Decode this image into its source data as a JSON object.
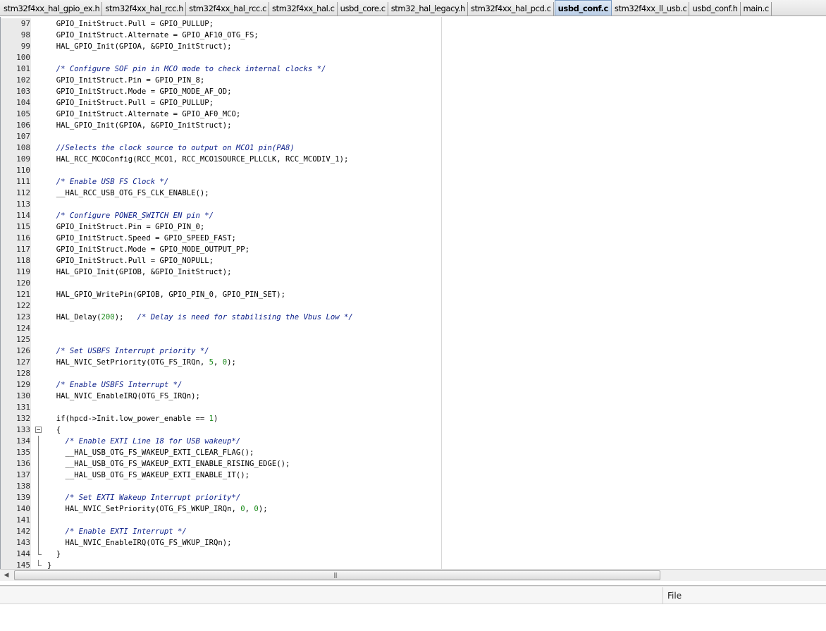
{
  "tabs": [
    {
      "label": "stm32f4xx_hal_gpio_ex.h",
      "active": false
    },
    {
      "label": "stm32f4xx_hal_rcc.h",
      "active": false
    },
    {
      "label": "stm32f4xx_hal_rcc.c",
      "active": false
    },
    {
      "label": "stm32f4xx_hal.c",
      "active": false
    },
    {
      "label": "usbd_core.c",
      "active": false
    },
    {
      "label": "stm32_hal_legacy.h",
      "active": false
    },
    {
      "label": "stm32f4xx_hal_pcd.c",
      "active": false
    },
    {
      "label": "usbd_conf.c",
      "active": true
    },
    {
      "label": "stm32f4xx_ll_usb.c",
      "active": false
    },
    {
      "label": "usbd_conf.h",
      "active": false
    },
    {
      "label": "main.c",
      "active": false
    }
  ],
  "editor": {
    "lines": [
      {
        "n": "97",
        "fold": "line",
        "code": "  GPIO_InitStruct.Pull = GPIO_PULLUP;"
      },
      {
        "n": "98",
        "fold": "line",
        "code": "  GPIO_InitStruct.Alternate = GPIO_AF10_OTG_FS;"
      },
      {
        "n": "99",
        "fold": "line",
        "code": "  HAL_GPIO_Init(GPIOA, &GPIO_InitStruct);"
      },
      {
        "n": "100",
        "fold": "line",
        "code": ""
      },
      {
        "n": "101",
        "fold": "line",
        "code": "  ",
        "comment": "/* Configure SOF pin in MCO mode to check internal clocks */"
      },
      {
        "n": "102",
        "fold": "line",
        "code": "  GPIO_InitStruct.Pin = GPIO_PIN_8;"
      },
      {
        "n": "103",
        "fold": "line",
        "code": "  GPIO_InitStruct.Mode = GPIO_MODE_AF_OD;"
      },
      {
        "n": "104",
        "fold": "line",
        "code": "  GPIO_InitStruct.Pull = GPIO_PULLUP;"
      },
      {
        "n": "105",
        "fold": "line",
        "code": "  GPIO_InitStruct.Alternate = GPIO_AF0_MCO;"
      },
      {
        "n": "106",
        "fold": "line",
        "code": "  HAL_GPIO_Init(GPIOA, &GPIO_InitStruct);"
      },
      {
        "n": "107",
        "fold": "line",
        "code": ""
      },
      {
        "n": "108",
        "fold": "line",
        "code": "  ",
        "comment": "//Selects the clock source to output on MCO1 pin(PA8)"
      },
      {
        "n": "109",
        "fold": "line",
        "code": "  HAL_RCC_MCOConfig(RCC_MCO1, RCC_MCO1SOURCE_PLLCLK, RCC_MCODIV_1);"
      },
      {
        "n": "110",
        "fold": "line",
        "code": ""
      },
      {
        "n": "111",
        "fold": "line",
        "code": "  ",
        "comment": "/* Enable USB FS Clock */"
      },
      {
        "n": "112",
        "fold": "line",
        "code": "  __HAL_RCC_USB_OTG_FS_CLK_ENABLE();"
      },
      {
        "n": "113",
        "fold": "line",
        "code": ""
      },
      {
        "n": "114",
        "fold": "line",
        "code": "  ",
        "comment": "/* Configure POWER_SWITCH EN pin */"
      },
      {
        "n": "115",
        "fold": "line",
        "code": "  GPIO_InitStruct.Pin = GPIO_PIN_0;"
      },
      {
        "n": "116",
        "fold": "line",
        "code": "  GPIO_InitStruct.Speed = GPIO_SPEED_FAST;"
      },
      {
        "n": "117",
        "fold": "line",
        "code": "  GPIO_InitStruct.Mode = GPIO_MODE_OUTPUT_PP;"
      },
      {
        "n": "118",
        "fold": "line",
        "code": "  GPIO_InitStruct.Pull = GPIO_NOPULL;"
      },
      {
        "n": "119",
        "fold": "line",
        "code": "  HAL_GPIO_Init(GPIOB, &GPIO_InitStruct);"
      },
      {
        "n": "120",
        "fold": "line",
        "code": ""
      },
      {
        "n": "121",
        "fold": "line",
        "code": "  HAL_GPIO_WritePin(GPIOB, GPIO_PIN_0, GPIO_PIN_SET);"
      },
      {
        "n": "122",
        "fold": "line",
        "code": ""
      },
      {
        "n": "123",
        "fold": "line",
        "code": "  HAL_Delay(",
        "num": "200",
        "code2": ");   ",
        "comment": "/* Delay is need for stabilising the Vbus Low */"
      },
      {
        "n": "124",
        "fold": "line",
        "code": ""
      },
      {
        "n": "125",
        "fold": "line",
        "code": ""
      },
      {
        "n": "126",
        "fold": "line",
        "code": "  ",
        "comment": "/* Set USBFS Interrupt priority */"
      },
      {
        "n": "127",
        "fold": "line",
        "code": "  HAL_NVIC_SetPriority(OTG_FS_IRQn, ",
        "num": "5",
        "code2": ", ",
        "num2": "0",
        "code3": ");"
      },
      {
        "n": "128",
        "fold": "line",
        "code": ""
      },
      {
        "n": "129",
        "fold": "line",
        "code": "  ",
        "comment": "/* Enable USBFS Interrupt */"
      },
      {
        "n": "130",
        "fold": "line",
        "code": "  HAL_NVIC_EnableIRQ(OTG_FS_IRQn);"
      },
      {
        "n": "131",
        "fold": "line",
        "code": ""
      },
      {
        "n": "132",
        "fold": "line",
        "code": "  if(hpcd->Init.low_power_enable == ",
        "num": "1",
        "code2": ")"
      },
      {
        "n": "133",
        "fold": "box",
        "code": "  {"
      },
      {
        "n": "134",
        "fold": "line",
        "code": "    ",
        "comment": "/* Enable EXTI Line 18 for USB wakeup*/"
      },
      {
        "n": "135",
        "fold": "line",
        "code": "    __HAL_USB_OTG_FS_WAKEUP_EXTI_CLEAR_FLAG();"
      },
      {
        "n": "136",
        "fold": "line",
        "code": "    __HAL_USB_OTG_FS_WAKEUP_EXTI_ENABLE_RISING_EDGE();"
      },
      {
        "n": "137",
        "fold": "line",
        "code": "    __HAL_USB_OTG_FS_WAKEUP_EXTI_ENABLE_IT();"
      },
      {
        "n": "138",
        "fold": "line",
        "code": ""
      },
      {
        "n": "139",
        "fold": "line",
        "code": "    ",
        "comment": "/* Set EXTI Wakeup Interrupt priority*/"
      },
      {
        "n": "140",
        "fold": "line",
        "code": "    HAL_NVIC_SetPriority(OTG_FS_WKUP_IRQn, ",
        "num": "0",
        "code2": ", ",
        "num2": "0",
        "code3": ");"
      },
      {
        "n": "141",
        "fold": "line",
        "code": ""
      },
      {
        "n": "142",
        "fold": "line",
        "code": "    ",
        "comment": "/* Enable EXTI Interrupt */"
      },
      {
        "n": "143",
        "fold": "line",
        "code": "    HAL_NVIC_EnableIRQ(OTG_FS_WKUP_IRQn);"
      },
      {
        "n": "144",
        "fold": "end",
        "code": "  }"
      },
      {
        "n": "145",
        "fold": "end",
        "code": "}"
      }
    ]
  },
  "scrollbar": {
    "left_arrow": "◀",
    "grip": "|||"
  },
  "panel": {
    "file_column_label": "File"
  },
  "colors": {
    "comment": "#0b1f8a",
    "number": "#1a8a1a",
    "active_tab": "#b9cde6"
  }
}
